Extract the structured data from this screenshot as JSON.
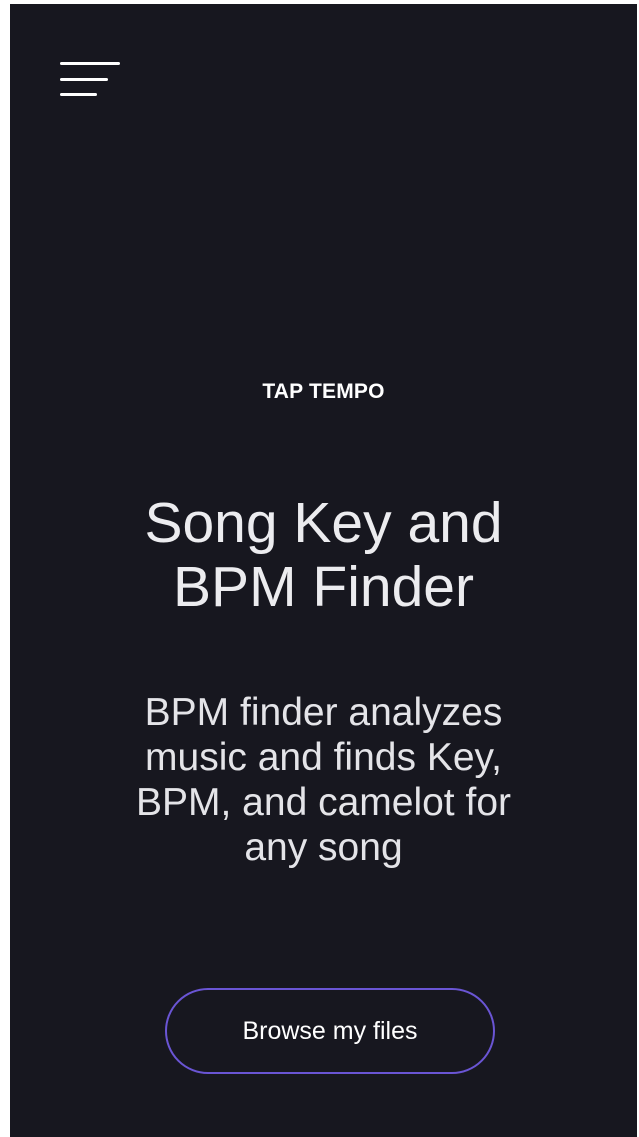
{
  "header": {
    "menu_icon": "hamburger-menu-icon"
  },
  "hero": {
    "eyebrow": "TAP TEMPO",
    "title_line1": "Song Key and",
    "title_line2": "BPM Finder",
    "subtitle_line1": "BPM finder analyzes",
    "subtitle_line2": "music and finds Key,",
    "subtitle_line3": "BPM, and camelot for",
    "subtitle_line4": "any song",
    "browse_label": "Browse my files"
  },
  "colors": {
    "background": "#17171f",
    "text": "#ececef",
    "button_border": "#6a55d4"
  }
}
